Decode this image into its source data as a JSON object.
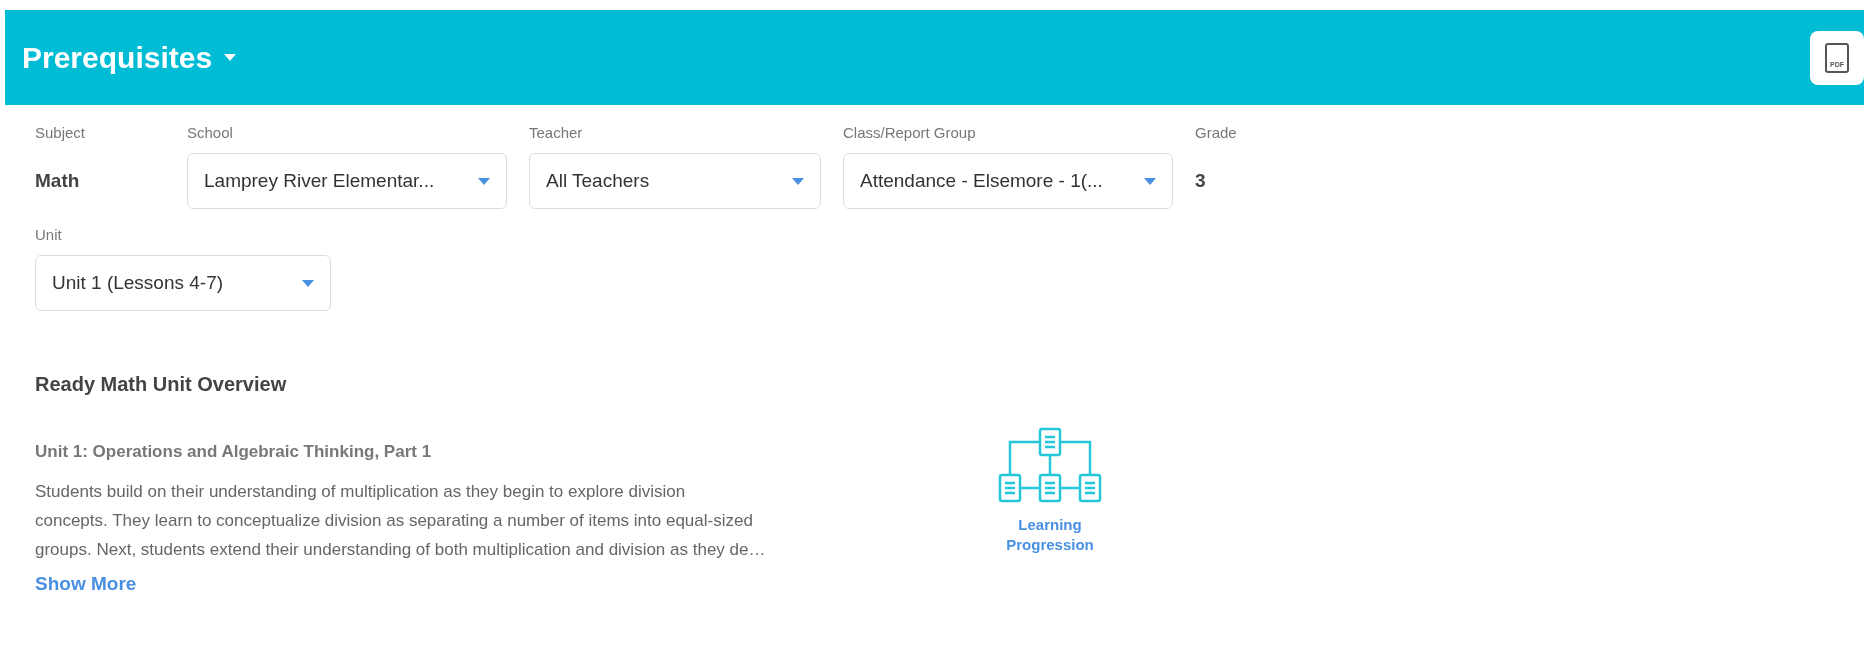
{
  "header": {
    "title": "Prerequisites",
    "pdf_button": "PDF"
  },
  "filters": [
    {
      "kind": "static",
      "label": "Subject",
      "value": "Math"
    },
    {
      "kind": "select",
      "label": "School",
      "value": "Lamprey River Elementar..."
    },
    {
      "kind": "select",
      "label": "Teacher",
      "value": "All Teachers"
    },
    {
      "kind": "select",
      "label": "Class/Report Group",
      "value": "Attendance - Elsemore - 1(..."
    },
    {
      "kind": "static",
      "label": "Grade",
      "value": "3"
    }
  ],
  "unit": {
    "label": "Unit",
    "value": "Unit 1 (Lessons 4-7)"
  },
  "overview": {
    "heading": "Ready Math Unit Overview",
    "unit_title": "Unit 1: Operations and Algebraic Thinking, Part 1",
    "description_lines": [
      "Students build on their understanding of multiplication as they begin to explore division",
      "concepts. They learn to conceptualize division as separating a number of items into equal-sized",
      "groups. Next, students extend their understanding of both multiplication and division as they de…"
    ],
    "show_more": "Show More",
    "learning_progression": "Learning Progression"
  }
}
